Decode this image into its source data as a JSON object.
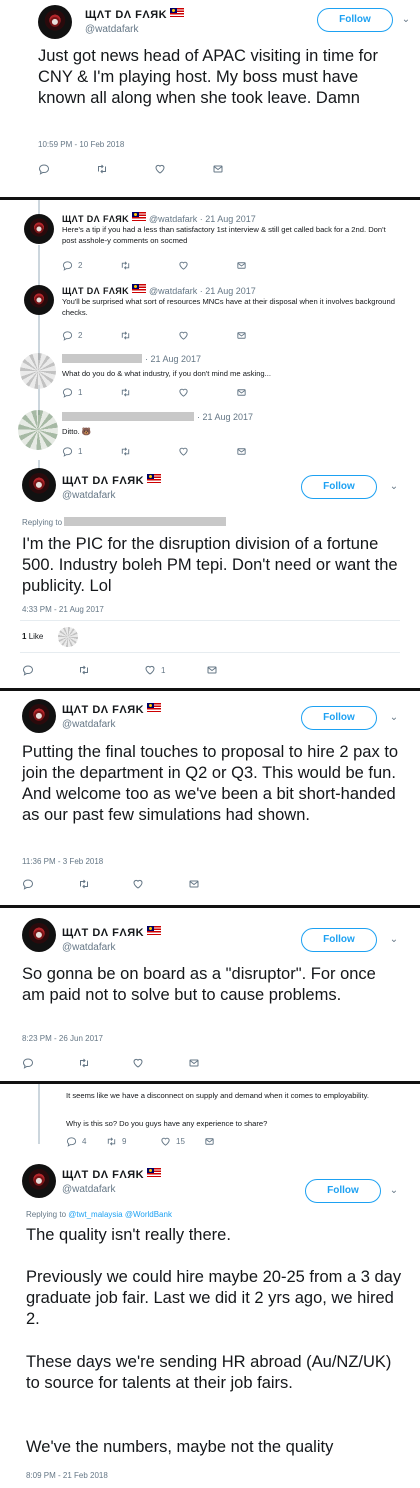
{
  "user": {
    "name": "ЩΛT DΛ FΛЯK",
    "handle": "@watdafark",
    "follow_label": "Follow"
  },
  "tweet1": {
    "text": "Just got news head of APAC visiting in time for CNY & I'm playing host. My boss must have known all along when she took leave. Damn",
    "timestamp": "10:59 PM - 10 Feb 2018"
  },
  "thread": {
    "r1": {
      "date": "@watdafark · 21 Aug 2017",
      "text": "Here's a tip if you had a less than satisfactory 1st interview & still get called back for a 2nd. Don't post asshole-y comments on socmed",
      "replies": "2"
    },
    "r2": {
      "date": "@watdafark · 21 Aug 2017",
      "text": "You'll be surprised what sort of resources MNCs have at their disposal when it involves background checks.",
      "replies": "2"
    },
    "r3": {
      "date": "· 21 Aug 2017",
      "text": "What do you do & what industry, if you don't mind me asking...",
      "replies": "1"
    },
    "r4": {
      "date": "· 21 Aug 2017",
      "text": "Ditto. 🐻",
      "replies": "1"
    }
  },
  "tweet2": {
    "replying_to": "Replying to",
    "text": "I'm the PIC for the disruption division of a fortune 500. Industry boleh PM tepi. Don't need or want the publicity. Lol",
    "timestamp": "4:33 PM - 21 Aug 2017",
    "likes_count": "1",
    "likes_label": "Like",
    "like_action_count": "1"
  },
  "tweet3": {
    "text": "Putting the final touches to proposal to hire 2 pax to join the department in Q2 or Q3. This would be fun. And welcome too as we've been a bit short-handed as our past few simulations had shown.",
    "timestamp": "11:36 PM - 3 Feb 2018"
  },
  "tweet4": {
    "text": "So gonna be on board as a \"disruptor\". For once am paid not to solve but to cause problems.",
    "timestamp": "8:23 PM - 26 Jun 2017"
  },
  "tweet5": {
    "quoted_text_1": "It seems like we have a disconnect on supply and demand when it comes to employability.",
    "quoted_text_2": "Why is this so? Do you guys have any experience to share?",
    "quoted_replies": "4",
    "quoted_retweets": "9",
    "quoted_likes": "15",
    "replying_prefix": "Replying to",
    "replying_handles": "@twt_malaysia @WorldBank",
    "para1": "The quality isn't really there.",
    "para2": "Previously we could hire maybe 20-25 from a 3 day graduate job fair. Last we did it 2 yrs ago, we hired 2.",
    "para3": "These days we're sending HR abroad (Au/NZ/UK) to source for talents at their job fairs.",
    "para4": "We've the numbers, maybe not the quality",
    "timestamp": "8:09 PM - 21 Feb 2018"
  },
  "icons": [
    "reply-icon",
    "retweet-icon",
    "heart-icon",
    "message-icon",
    "chevron-down-icon",
    "flag-icon"
  ],
  "colors": {
    "accent": "#1da1f2",
    "muted": "#657786",
    "text": "#14171a",
    "divider": "#111111"
  }
}
